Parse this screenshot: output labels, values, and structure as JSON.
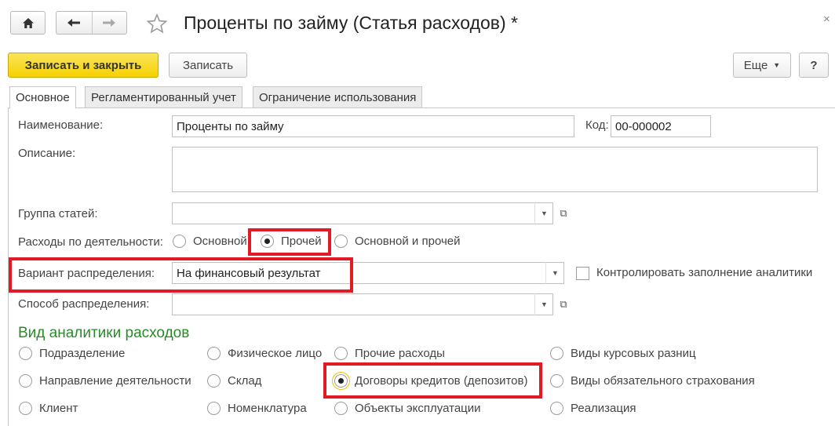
{
  "window": {
    "title": "Проценты по займу (Статья расходов) *",
    "close_icon": "×"
  },
  "toolbar": {
    "save_close_label": "Записать и закрыть",
    "save_label": "Записать",
    "more_label": "Еще",
    "help_label": "?"
  },
  "tabs": [
    {
      "label": "Основное",
      "active": true
    },
    {
      "label": "Регламентированный учет",
      "active": false
    },
    {
      "label": "Ограничение использования",
      "active": false
    }
  ],
  "form": {
    "name_label": "Наименование:",
    "name_value": "Проценты по займу",
    "code_label": "Код:",
    "code_value": "00-000002",
    "description_label": "Описание:",
    "description_value": "",
    "group_label": "Группа статей:",
    "group_value": "",
    "activity_label": "Расходы по деятельности:",
    "activity_options": [
      "Основной",
      "Прочей",
      "Основной и прочей"
    ],
    "activity_selected": "Прочей",
    "distribution_variant_label": "Вариант распределения:",
    "distribution_variant_value": "На финансовый результат",
    "control_analytics_label": "Контролировать заполнение аналитики",
    "distribution_method_label": "Способ распределения:",
    "distribution_method_value": ""
  },
  "analytics": {
    "section_title": "Вид аналитики расходов",
    "options": [
      "Подразделение",
      "Физическое лицо",
      "Прочие расходы",
      "Виды курсовых разниц",
      "Направление деятельности",
      "Склад",
      "Договоры кредитов (депозитов)",
      "Виды обязательного страхования",
      "Клиент",
      "Номенклатура",
      "Объекты эксплуатации",
      "Реализация"
    ],
    "selected": "Договоры кредитов (депозитов)"
  },
  "colors": {
    "accent_yellow": "#f5d100",
    "highlight_red": "#e01b24",
    "section_green": "#2a8a2a"
  }
}
